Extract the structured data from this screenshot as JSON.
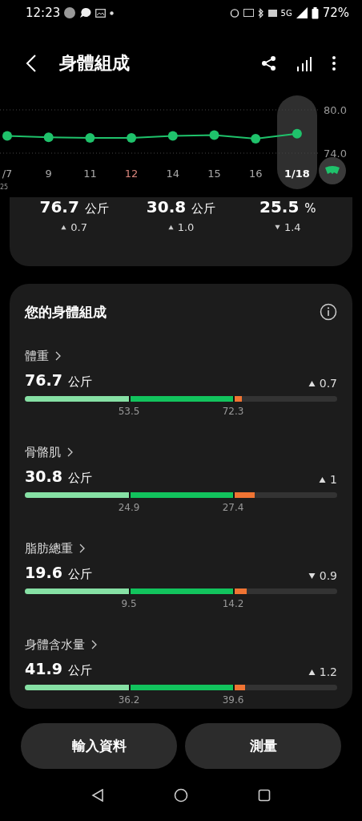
{
  "status_bar": {
    "time": "12:23",
    "battery": "72%",
    "network": "5G"
  },
  "header": {
    "title": "身體組成"
  },
  "trend_chart": {
    "year_label": "25",
    "days": [
      {
        "selected": false,
        "weekend": false
      },
      {
        "selected": false,
        "weekend": false
      },
      {
        "selected": false,
        "weekend": false
      },
      {
        "selected": false,
        "weekend": true
      },
      {
        "selected": false,
        "weekend": false
      },
      {
        "selected": false,
        "weekend": false
      },
      {
        "selected": false,
        "weekend": false
      },
      {
        "selected": true,
        "weekend": false
      }
    ],
    "chart_data": {
      "type": "line",
      "categories": [
        "/7",
        "9",
        "11",
        "12",
        "14",
        "15",
        "16",
        "1/18"
      ],
      "ylim": [
        74,
        80
      ],
      "yticks": [
        {
          "value": 80,
          "label": "80.0"
        },
        {
          "value": 74,
          "label": "74.0"
        }
      ],
      "series": [
        {
          "color": "#1fc26b",
          "marker": "o",
          "values": [
            76.4,
            76.2,
            76.1,
            76.1,
            76.4,
            76.5,
            76.0,
            76.7
          ]
        }
      ]
    }
  },
  "summary": [
    {
      "value": "76.7",
      "unit": "公斤",
      "increased": true,
      "delta": "0.7"
    },
    {
      "value": "30.8",
      "unit": "公斤",
      "increased": true,
      "delta": "1.0"
    },
    {
      "value": "25.5",
      "unit": "%",
      "increased": false,
      "delta": "1.4"
    }
  ],
  "composition": {
    "title": "您的身體組成",
    "metrics": [
      {
        "name": "體重",
        "value": "76.7",
        "unit": "公斤",
        "increased": true,
        "delta": "0.7",
        "low": "53.5",
        "high": "72.3",
        "level": 0.69
      },
      {
        "name": "骨骼肌",
        "value": "30.8",
        "unit": "公斤",
        "increased": true,
        "delta": "1",
        "low": "24.9",
        "high": "27.4",
        "level": 0.73
      },
      {
        "name": "脂肪總重",
        "value": "19.6",
        "unit": "公斤",
        "increased": false,
        "delta": "0.9",
        "low": "9.5",
        "high": "14.2",
        "level": 0.705
      },
      {
        "name": "身體含水量",
        "value": "41.9",
        "unit": "公斤",
        "increased": true,
        "delta": "1.2",
        "low": "36.2",
        "high": "39.6",
        "level": 0.7
      }
    ]
  },
  "buttons": [
    "輸入資料",
    "測量"
  ]
}
